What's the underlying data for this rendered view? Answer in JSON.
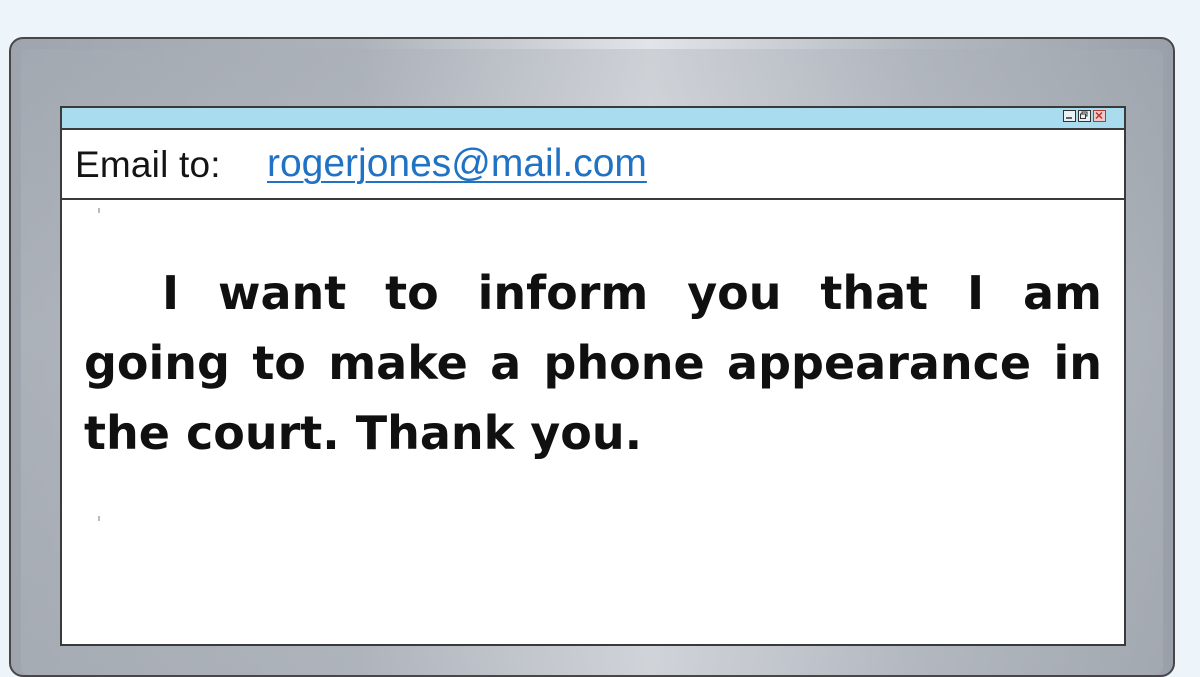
{
  "window": {
    "controls": [
      "minimize-icon",
      "maximize-icon",
      "close-icon"
    ]
  },
  "email": {
    "label": "Email to:",
    "address": "rogerjones@mail.com"
  },
  "message": {
    "body": "I want to inform you that I am going to make a phone appearance in the court. Thank you."
  },
  "colors": {
    "title_bar": "#a9dcef",
    "link": "#1f72c4",
    "close_button": "#b23a32",
    "background": "#eef5fa"
  }
}
